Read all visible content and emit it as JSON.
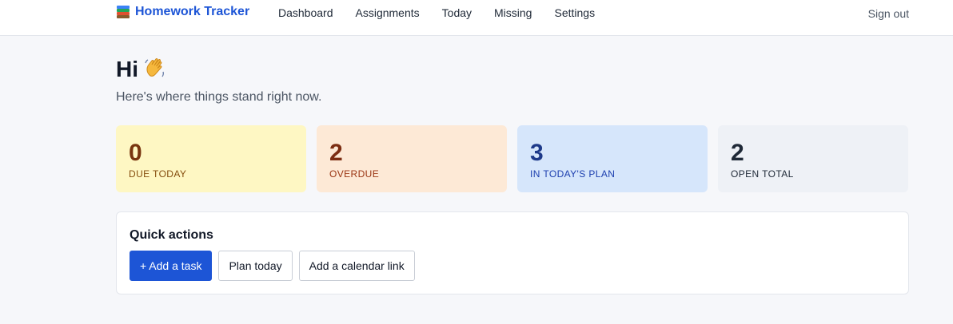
{
  "header": {
    "brand": "Homework Tracker",
    "brand_icon": "books-icon",
    "nav": [
      "Dashboard",
      "Assignments",
      "Today",
      "Missing",
      "Settings"
    ],
    "sign_out": "Sign out"
  },
  "greeting": {
    "title": "Hi",
    "icon": "waving-hand-icon",
    "subtitle": "Here's where things stand right now."
  },
  "stats": [
    {
      "value": "0",
      "label": "DUE TODAY",
      "bg": "#fef7c3"
    },
    {
      "value": "2",
      "label": "OVERDUE",
      "bg": "#fde9d6"
    },
    {
      "value": "3",
      "label": "IN TODAY'S PLAN",
      "bg": "#d6e6fb"
    },
    {
      "value": "2",
      "label": "OPEN TOTAL",
      "bg": "#eef1f6"
    }
  ],
  "quick_actions": {
    "title": "Quick actions",
    "add_task": "+ Add a task",
    "plan_today": "Plan today",
    "add_calendar": "Add a calendar link"
  },
  "colors": {
    "accent": "#1d55d6",
    "page_bg": "#f6f7fa"
  }
}
